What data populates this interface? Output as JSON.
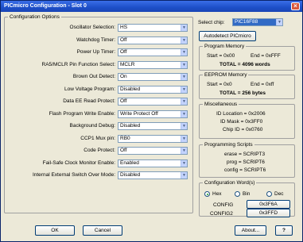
{
  "window": {
    "title": "PICmicro Configuration - Slot 0",
    "close_glyph": "×"
  },
  "config_options": {
    "group_label": "Configuration Options",
    "rows": [
      {
        "label": "Oscillator Selection:",
        "value": "HS"
      },
      {
        "label": "Watchdog Timer:",
        "value": "Off"
      },
      {
        "label": "Power Up Timer:",
        "value": "Off"
      },
      {
        "label": "RA5/MCLR Pin Function Select:",
        "value": "MCLR"
      },
      {
        "label": "Brown Out Detect:",
        "value": "On"
      },
      {
        "label": "Low Voltage Program:",
        "value": "Disabled"
      },
      {
        "label": "Data EE Read Protect:",
        "value": "Off"
      },
      {
        "label": "Flash Program Write Enable:",
        "value": "Write Protect Off"
      },
      {
        "label": "Background Debug:",
        "value": "Disabled"
      },
      {
        "label": "CCP1 Mux pin:",
        "value": "RB0"
      },
      {
        "label": "Code Protect:",
        "value": "Off"
      },
      {
        "label": "Fail-Safe Clock Monitor Enable:",
        "value": "Enabled"
      },
      {
        "label": "Internal External Switch Over Mode:",
        "value": "Disabled"
      }
    ]
  },
  "chip": {
    "label": "Select chip:",
    "value": "PIC16F88",
    "autodetect_label": "Autodetect PICmicro"
  },
  "program_memory": {
    "group_label": "Program Memory",
    "start": "Start = 0x00",
    "end": "End = 0xFFF",
    "total": "TOTAL = 4096 words"
  },
  "eeprom_memory": {
    "group_label": "EEPROM Memory",
    "start": "Start = 0x0",
    "end": "End = 0xff",
    "total": "TOTAL = 256 bytes"
  },
  "misc": {
    "group_label": "Miscellaneous",
    "id_location": "ID Location = 0x2006",
    "id_mask": "ID Mask = 0x3FF0",
    "chip_id": "Chip ID = 0x0760"
  },
  "scripts": {
    "group_label": "Programming Scripts",
    "erase": "erase = SCRIPT3",
    "prog": "prog = SCRIPT6",
    "config": "config = SCRIPT6"
  },
  "config_words": {
    "group_label": "Configuration Word(s)",
    "radix_options": [
      "Hex",
      "Bin",
      "Dec"
    ],
    "selected_radix": "Hex",
    "config_label": "CONFIG",
    "config_value": "0x3F6A",
    "config2_label": "CONFIG2",
    "config2_value": "0x3FFD"
  },
  "footer": {
    "ok_label": "OK",
    "cancel_label": "Cancel",
    "about_label": "About...",
    "help_label": "?"
  }
}
